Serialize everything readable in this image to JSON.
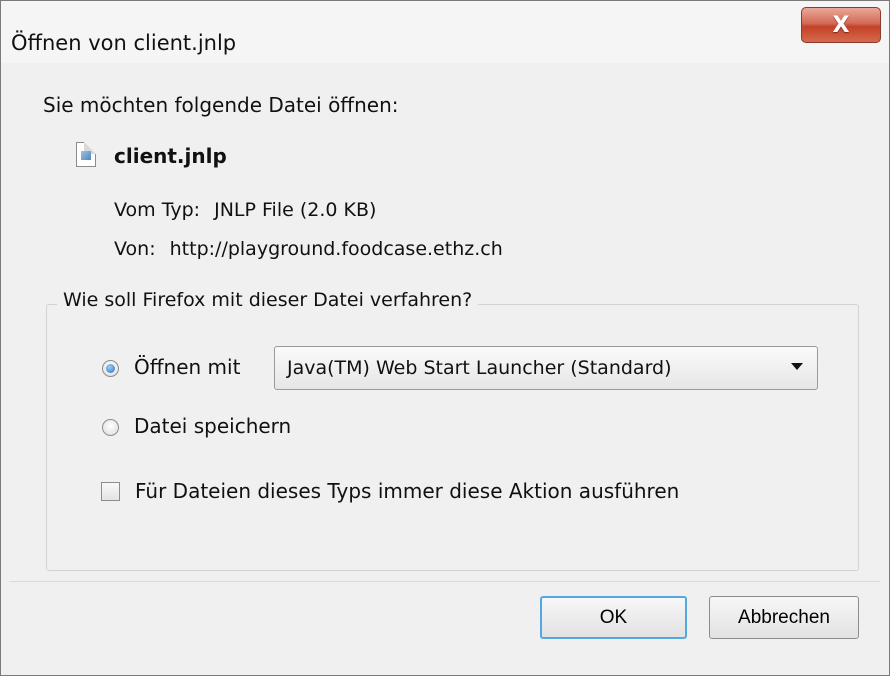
{
  "window": {
    "title": "Öffnen von client.jnlp",
    "close_label": "X"
  },
  "file": {
    "prompt": "Sie möchten folgende Datei öffnen:",
    "name": "client.jnlp",
    "type_label": "Vom Typ:",
    "type_value": "JNLP File (2.0 KB)",
    "from_label": "Von:",
    "from_value": "http://playground.foodcase.ethz.ch"
  },
  "action_group": {
    "legend": "Wie soll Firefox mit dieser Datei verfahren?",
    "open_with_label": "Öffnen mit",
    "open_with_app": "Java(TM) Web Start Launcher (Standard)",
    "save_label": "Datei speichern",
    "always_label": "Für Dateien dieses Typs immer diese Aktion ausführen",
    "selected_option": "open_with",
    "always_checked": false
  },
  "buttons": {
    "ok": "OK",
    "cancel": "Abbrechen"
  },
  "icons": {
    "file": "file-icon",
    "close": "close-icon",
    "dropdown": "chevron-down-icon"
  }
}
